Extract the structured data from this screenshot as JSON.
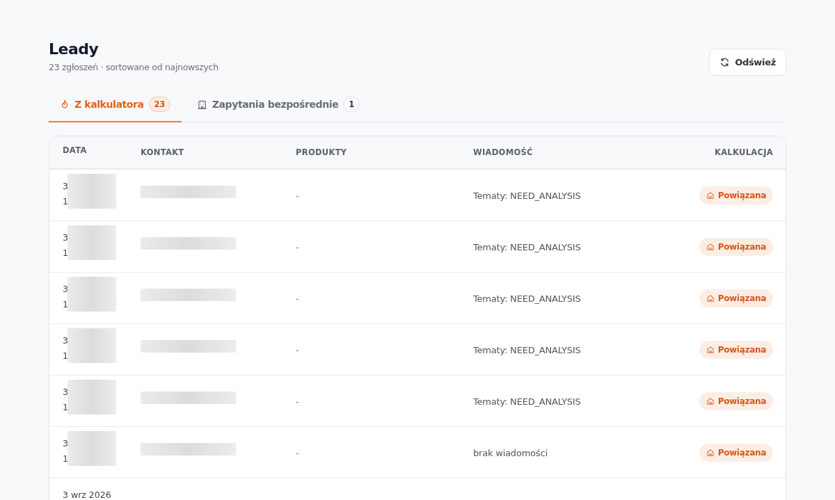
{
  "header": {
    "title": "Leady",
    "subtitle": "23 zgłoszeń · sortowane od najnowszych",
    "refresh_button": "Odśwież"
  },
  "tabs": [
    {
      "label": "Z kalkulatora",
      "count": "23",
      "selected": true
    },
    {
      "label": "Zapytania bezpośrednie",
      "count": "1",
      "selected": false
    }
  ],
  "table": {
    "columns": [
      "DATA",
      "KONTAKT",
      "PRODUKTY",
      "WIADOMOŚĆ",
      "KALKULACJA"
    ],
    "rows": [
      {
        "date": [
          "3",
          "1"
        ],
        "redacted": true,
        "products": "-",
        "message": "Tematy: NEED_ANALYSIS",
        "calculation": "Powiązana"
      },
      {
        "date": [
          "3",
          "1"
        ],
        "redacted": true,
        "products": "-",
        "message": "Tematy: NEED_ANALYSIS",
        "calculation": "Powiązana"
      },
      {
        "date": [
          "3",
          "1"
        ],
        "redacted": true,
        "products": "-",
        "message": "Tematy: NEED_ANALYSIS",
        "calculation": "Powiązana"
      },
      {
        "date": [
          "3",
          "1"
        ],
        "redacted": true,
        "products": "-",
        "message": "Tematy: NEED_ANALYSIS",
        "calculation": "Powiązana"
      },
      {
        "date": [
          "3",
          "1"
        ],
        "redacted": true,
        "products": "-",
        "message": "Tematy: NEED_ANALYSIS",
        "calculation": "Powiązana"
      },
      {
        "date": [
          "3",
          "1"
        ],
        "redacted": true,
        "products": "-",
        "message": "brak wiadomości",
        "calculation": "Powiązana"
      },
      {
        "date": [
          "3 wrz 2026"
        ]
      }
    ]
  }
}
